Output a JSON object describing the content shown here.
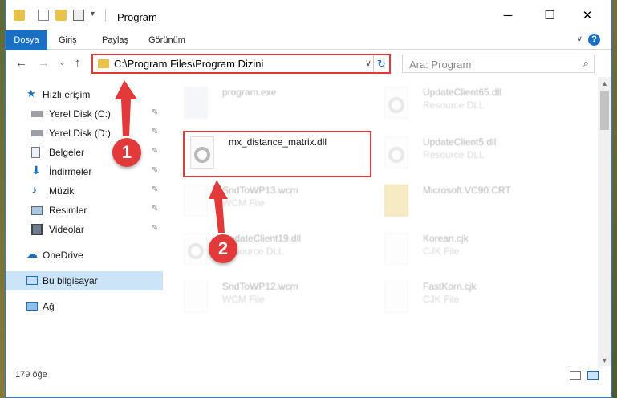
{
  "window": {
    "title": "Program",
    "minimize_glyph": "─",
    "maximize_glyph": "☐",
    "close_glyph": "✕"
  },
  "ribbon": {
    "tabs": [
      {
        "label": "Dosya",
        "active": true
      },
      {
        "label": "Giriş"
      },
      {
        "label": "Paylaş"
      },
      {
        "label": "Görünüm"
      }
    ],
    "help_label": "?"
  },
  "nav": {
    "back_glyph": "←",
    "forward_glyph": "→",
    "recent_glyph": "⌄",
    "up_glyph": "↑",
    "address_path": "C:\\Program Files\\Program Dizini",
    "dropdown_glyph": "∨",
    "refresh_glyph": "↻",
    "search_placeholder": "Ara: Program",
    "search_glyph": "⌕"
  },
  "sidebar": {
    "items": [
      {
        "label": "Hızlı erişim",
        "icon": "star-icon"
      },
      {
        "label": "Yerel Disk (C:)",
        "icon": "drive-icon",
        "pinned": true
      },
      {
        "label": "Yerel Disk (D:)",
        "icon": "drive-icon",
        "pinned": true
      },
      {
        "label": "Belgeler",
        "icon": "documents-icon",
        "pinned": true
      },
      {
        "label": "İndirmeler",
        "icon": "download-icon",
        "pinned": true
      },
      {
        "label": "Müzik",
        "icon": "music-icon",
        "pinned": true
      },
      {
        "label": "Resimler",
        "icon": "pictures-icon",
        "pinned": true
      },
      {
        "label": "Videolar",
        "icon": "videos-icon",
        "pinned": true
      },
      {
        "label": "OneDrive",
        "icon": "onedrive-icon"
      },
      {
        "label": "Bu bilgisayar",
        "icon": "computer-icon",
        "selected": true
      },
      {
        "label": "Ağ",
        "icon": "network-icon"
      }
    ],
    "pin_glyph": "📌"
  },
  "files": [
    {
      "name": "program.exe",
      "type": ""
    },
    {
      "name": "UpdateClient65.dll",
      "type": "Resource DLL"
    },
    {
      "name": "mx_distance_matrix.dll",
      "type": ""
    },
    {
      "name": "UpdateClient5.dll",
      "type": "Resource DLL"
    },
    {
      "name": "SndToWP13.wcm",
      "type": "WCM File"
    },
    {
      "name": "Microsoft.VC90.CRT",
      "type": ""
    },
    {
      "name": "UpdateClient19.dll",
      "type": "Resource DLL"
    },
    {
      "name": "Korean.cjk",
      "type": "CJK File"
    },
    {
      "name": "SndToWP12.wcm",
      "type": "WCM File"
    },
    {
      "name": "FastKorn.cjk",
      "type": "CJK File"
    }
  ],
  "status": {
    "item_count": "179 öğe"
  },
  "callouts": [
    "1",
    "2"
  ],
  "colors": {
    "accent": "#1a6fc4",
    "highlight_red": "#e23a3a",
    "selected_bg": "#cce4f7"
  }
}
